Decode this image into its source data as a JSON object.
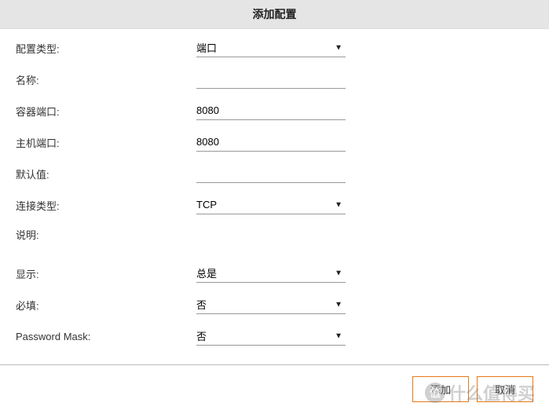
{
  "dialog": {
    "title": "添加配置"
  },
  "fields": {
    "configType": {
      "label": "配置类型:",
      "value": "端口"
    },
    "name": {
      "label": "名称:",
      "value": ""
    },
    "containerPort": {
      "label": "容器端口:",
      "value": "8080"
    },
    "hostPort": {
      "label": "主机端口:",
      "value": "8080"
    },
    "defaultValue": {
      "label": "默认值:",
      "value": ""
    },
    "connType": {
      "label": "连接类型:",
      "value": "TCP"
    },
    "description": {
      "label": "说明:",
      "value": ""
    },
    "display": {
      "label": "显示:",
      "value": "总是"
    },
    "required": {
      "label": "必填:",
      "value": "否"
    },
    "passwordMask": {
      "label": "Password Mask:",
      "value": "否"
    }
  },
  "footer": {
    "add": "添加",
    "cancel": "取消"
  },
  "watermark": {
    "iconText": "值",
    "text": "什么值得买"
  }
}
